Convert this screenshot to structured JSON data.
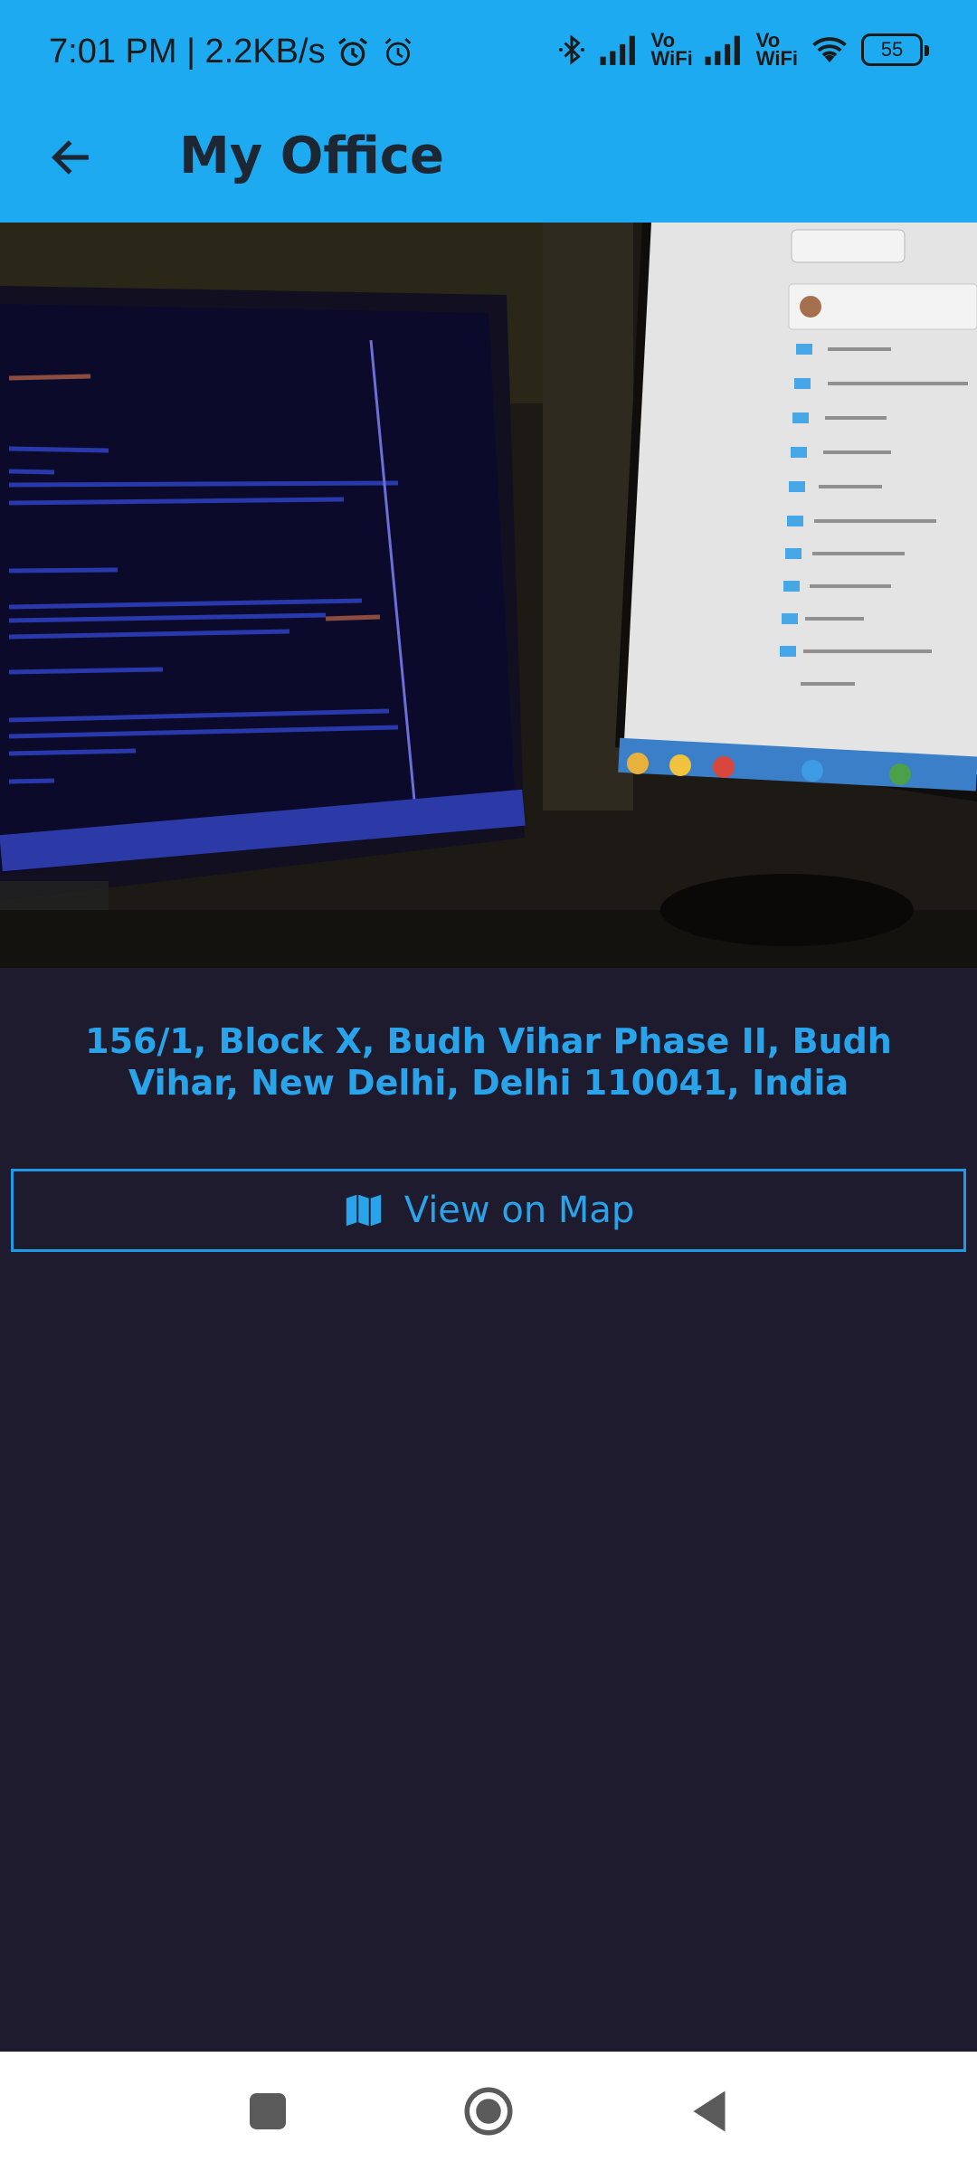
{
  "status_bar": {
    "time_speed": "7:01 PM | 2.2KB/s",
    "vowifi_1_top": "Vo",
    "vowifi_1_bottom": "WiFi",
    "vowifi_2_top": "Vo",
    "vowifi_2_bottom": "WiFi",
    "battery_level": "55"
  },
  "app_bar": {
    "title": "My Office",
    "back_icon": "arrow-left-icon"
  },
  "place": {
    "photo_alt": "Office photo",
    "address": "156/1, Block X, Budh Vihar Phase II, Budh Vihar, New Delhi, Delhi 110041, India"
  },
  "actions": {
    "view_map_label": "View on Map",
    "view_map_icon": "map-icon"
  },
  "colors": {
    "app_bar": "#1eaaf1",
    "background": "#1f1b2e",
    "accent": "#29a3ea"
  }
}
